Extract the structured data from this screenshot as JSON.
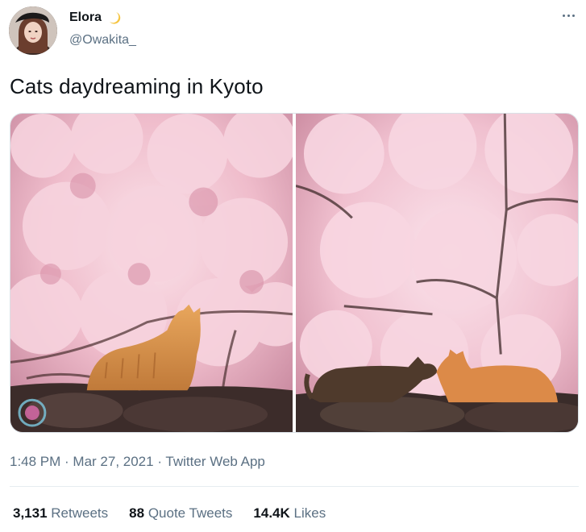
{
  "author": {
    "name": "Elora",
    "handle": "@Owakita_",
    "badge_icon": "crescent-moon-icon"
  },
  "menu_icon": "more-options-icon",
  "tweet": {
    "text": "Cats daydreaming in Kyoto"
  },
  "meta": {
    "time": "1:48 PM",
    "separator": " · ",
    "date": "Mar 27, 2021",
    "source": "Twitter Web App"
  },
  "stats": {
    "retweets_count": "3,131",
    "retweets_label": "Retweets",
    "quotes_count": "88",
    "quotes_label": "Quote Tweets",
    "likes_count": "14.4K",
    "likes_label": "Likes"
  },
  "colors": {
    "text_primary": "#0f1419",
    "text_secondary": "#5b7083",
    "blossom_pink": "#f2c6d4",
    "cat_orange": "#d9964e"
  }
}
